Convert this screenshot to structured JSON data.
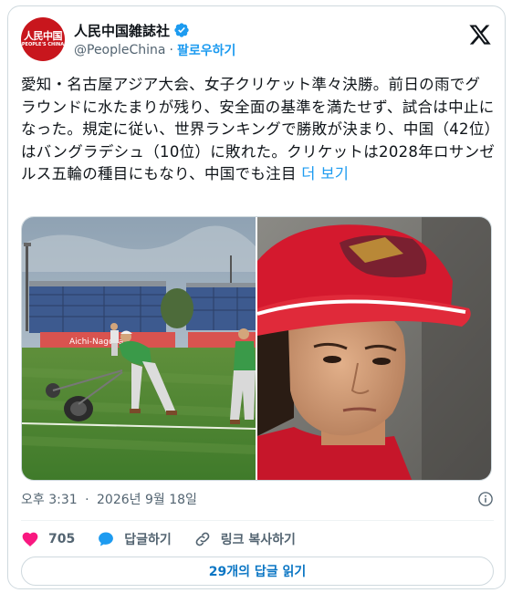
{
  "account": {
    "display_name": "人民中国雑誌社",
    "handle": "@PeopleChina",
    "follow_label": "팔로우하기",
    "avatar_text_cn": "人民中国",
    "avatar_text_en": "PEOPLE'S CHINA"
  },
  "tweet": {
    "text": "愛知・名古屋アジア大会、女子クリケット準々決勝。前日の雨でグラウンドに水たまりが残り、安全面の基準を満たせず、試合は中止になった。規定に従い、世界ランキングで勝敗が決まり、中国（42位）はバングラデシュ（10位）に敗れた。クリケットは2028年ロサンゼルス五輪の種目にもなり、中国でも注目",
    "more_label": "더 보기",
    "banner_text": "Aichi-Nagoya"
  },
  "meta": {
    "time": "오후 3:31",
    "date": "2026년 9월 18일"
  },
  "actions": {
    "like_count": "705",
    "reply_label": "답글하기",
    "copy_link_label": "링크 복사하기"
  },
  "replies_button": "29개의 답글 읽기",
  "colors": {
    "accent": "#1d9bf0",
    "like": "#f91880",
    "brand_red": "#c8161d"
  }
}
